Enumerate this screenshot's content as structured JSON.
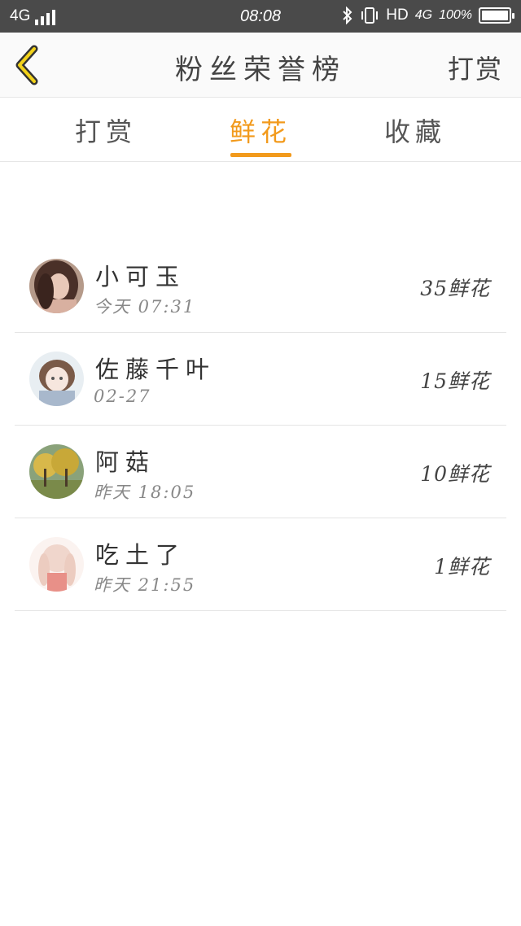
{
  "status_bar": {
    "network": "4G",
    "time": "08:08",
    "bluetooth_icon": "bluetooth-icon",
    "vibrate_icon": "vibrate-icon",
    "hd": "HD",
    "network_right": "4G",
    "battery_percent": "100%",
    "battery_level": 1.0
  },
  "header": {
    "back_icon": "chevron-left-icon",
    "title": "粉丝荣誉榜",
    "right_action": "打赏",
    "accent_color": "#f29a1c"
  },
  "tabs": [
    {
      "label": "打赏",
      "active": false
    },
    {
      "label": "鲜花",
      "active": true
    },
    {
      "label": "收藏",
      "active": false
    }
  ],
  "fans": [
    {
      "name": "小可玉",
      "time": "今天 07:31",
      "count": "35鲜花",
      "avatar": "avatar-girl-dark-hair"
    },
    {
      "name": "佐藤千叶",
      "time": "02-27",
      "count": "15鲜花",
      "avatar": "avatar-anime-girl"
    },
    {
      "name": "阿菇",
      "time": "昨天 18:05",
      "count": "10鲜花",
      "avatar": "avatar-autumn-trees"
    },
    {
      "name": "吃土了",
      "time": "昨天 21:55",
      "count": "1鲜花",
      "avatar": "avatar-pink-girl"
    }
  ]
}
